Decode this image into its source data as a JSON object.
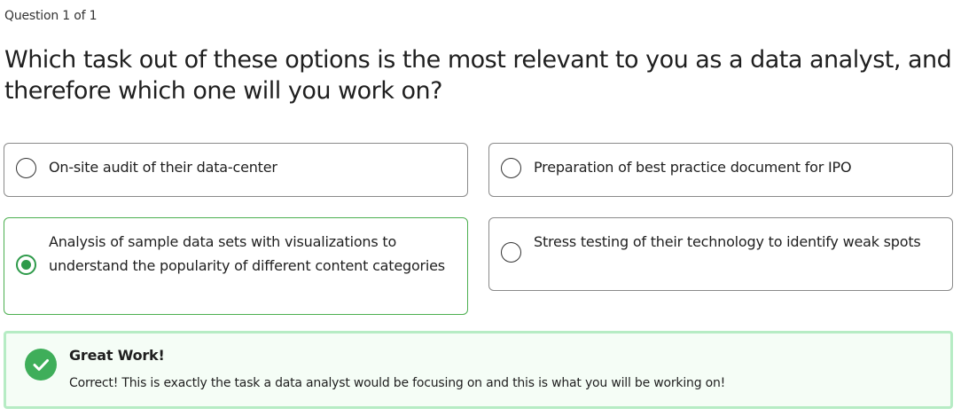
{
  "quiz": {
    "counter": "Question 1 of 1",
    "question": "Which task out of these options is the most relevant to you as a data analyst, and therefore which one will you work on?",
    "options": [
      {
        "label": "On-site audit of their data-center",
        "selected": false
      },
      {
        "label": "Preparation of best practice document for IPO",
        "selected": false
      },
      {
        "label": "Analysis of sample data sets with visualizations to understand the popularity of different content categories",
        "selected": true
      },
      {
        "label": "Stress testing of their technology to identify weak spots",
        "selected": false
      }
    ]
  },
  "feedback": {
    "icon": "check-circle-icon",
    "title": "Great Work!",
    "message": "Correct! This is exactly the task a data analyst would be focusing on and this is what you will be working on!"
  },
  "colors": {
    "accent_green": "#2e9a4a",
    "feedback_border": "#b6ecc4",
    "feedback_background": "#f5fdf6"
  }
}
